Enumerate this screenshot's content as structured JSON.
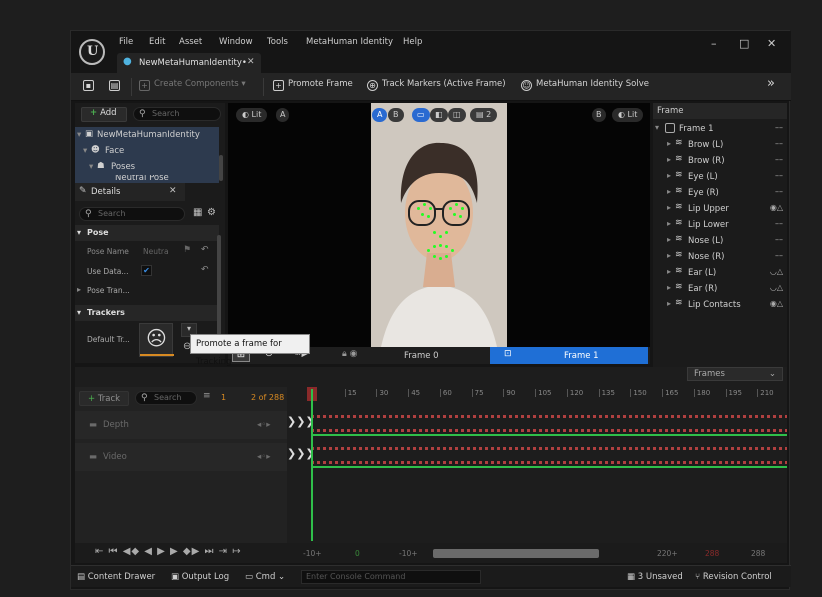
{
  "menu": [
    "File",
    "Edit",
    "Asset",
    "Window",
    "Tools",
    "MetaHuman Identity",
    "Help"
  ],
  "document_tab": {
    "label": "NewMetaHumanIdentity•"
  },
  "window_controls": {
    "minimize": "–",
    "maximize": "□",
    "close": "✕"
  },
  "toolbar": {
    "create_components": "Create Components",
    "promote_frame": "Promote Frame",
    "track_markers": "Track Markers (Active Frame)",
    "identity_solve": "MetaHuman Identity Solve",
    "overflow": "»"
  },
  "outliner": {
    "add_label": "Add",
    "search_placeholder": "Search",
    "items": [
      "NewMetaHumanIdentity",
      "Face",
      "Poses",
      "Neutral Pose"
    ]
  },
  "details": {
    "tab_label": "Details",
    "search_placeholder": "Search",
    "section_pose": "Pose",
    "pose_name_label": "Pose Name",
    "pose_name_value": "Neutra",
    "use_data_label": "Use Data...",
    "pose_transform_label": "Pose Tran...",
    "section_trackers": "Trackers",
    "default_tracker_label": "Default Tr..."
  },
  "viewport": {
    "lit_left": "Lit",
    "a_left": "A",
    "a_btn": "A",
    "b_btn": "B",
    "layer_count": "2",
    "b_right": "B",
    "lit_right": "Lit"
  },
  "viewport_bar": {
    "frame0": "Frame 0",
    "frame1": "Frame 1"
  },
  "tooltip": "Promote a frame for Tracking",
  "frame_panel": {
    "header": "Frame",
    "root": "Frame 1",
    "items": [
      {
        "label": "Brow (L)",
        "state": "––"
      },
      {
        "label": "Brow (R)",
        "state": "––"
      },
      {
        "label": "Eye (L)",
        "state": "––"
      },
      {
        "label": "Eye (R)",
        "state": "––"
      },
      {
        "label": "Lip Upper",
        "state": "◉△"
      },
      {
        "label": "Lip Lower",
        "state": "––"
      },
      {
        "label": "Nose (L)",
        "state": "––"
      },
      {
        "label": "Nose (R)",
        "state": "––"
      },
      {
        "label": "Ear (L)",
        "state": "◡△"
      },
      {
        "label": "Ear (R)",
        "state": "◡△"
      },
      {
        "label": "Lip Contacts",
        "state": "◉△"
      }
    ]
  },
  "sequencer": {
    "track_label": "Track",
    "search_placeholder": "Search",
    "frame_current": "1",
    "frame_count": "2 of 288",
    "frames_dropdown": "Frames",
    "tracks": [
      "Depth",
      "Video"
    ],
    "ruler": [
      "15",
      "30",
      "45",
      "60",
      "75",
      "90",
      "105",
      "120",
      "135",
      "150",
      "165",
      "180",
      "195",
      "210"
    ],
    "range_start": "-10+",
    "range_zero": "0",
    "range_mid": "-10+",
    "range_end_a": "220+",
    "range_end_b": "288",
    "range_end_c": "288"
  },
  "status_bar": {
    "content_drawer": "Content Drawer",
    "output_log": "Output Log",
    "cmd": "Cmd",
    "console_placeholder": "Enter Console Command",
    "unsaved": "3 Unsaved",
    "revision_control": "Revision Control"
  },
  "colors": {
    "accent_blue": "#1f6fd6",
    "tracker_green": "#22ff22",
    "playhead_green": "#2fbf4a"
  }
}
